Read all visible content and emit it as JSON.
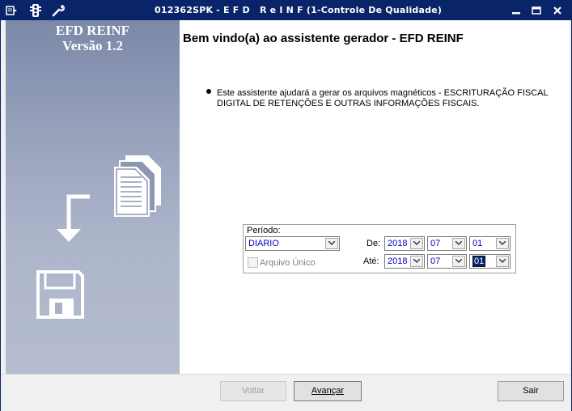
{
  "window": {
    "title": "012362SPK - E F D   R e I N F (1-Controle De Qualidade)"
  },
  "sidebar": {
    "product_name": "EFD REINF",
    "product_version": "Versão 1.2"
  },
  "main": {
    "heading": "Bem vindo(a) ao assistente gerador - EFD REINF",
    "intro": "Este assistente ajudará a gerar os arquivos magnéticos - ESCRITURAÇÃO FISCAL DIGITAL DE RETENÇÕES E OUTRAS INFORMAÇÕES FISCAIS."
  },
  "period": {
    "label": "Período:",
    "type_value": "DIARIO",
    "single_file_label": "Arquivo Único",
    "single_file_checked": false,
    "from_label": "De:",
    "to_label": "Até:",
    "from": {
      "year": "2018",
      "month": "07",
      "day": "01"
    },
    "to": {
      "year": "2018",
      "month": "07",
      "day": "01"
    }
  },
  "buttons": {
    "back": "Voltar",
    "next": "Avançar",
    "exit": "Sair"
  },
  "colors": {
    "titlebar": "#0a246a",
    "sidebar_top": "#7b88a8",
    "sidebar_bottom": "#b5bccf",
    "field_text": "#0000c0"
  }
}
